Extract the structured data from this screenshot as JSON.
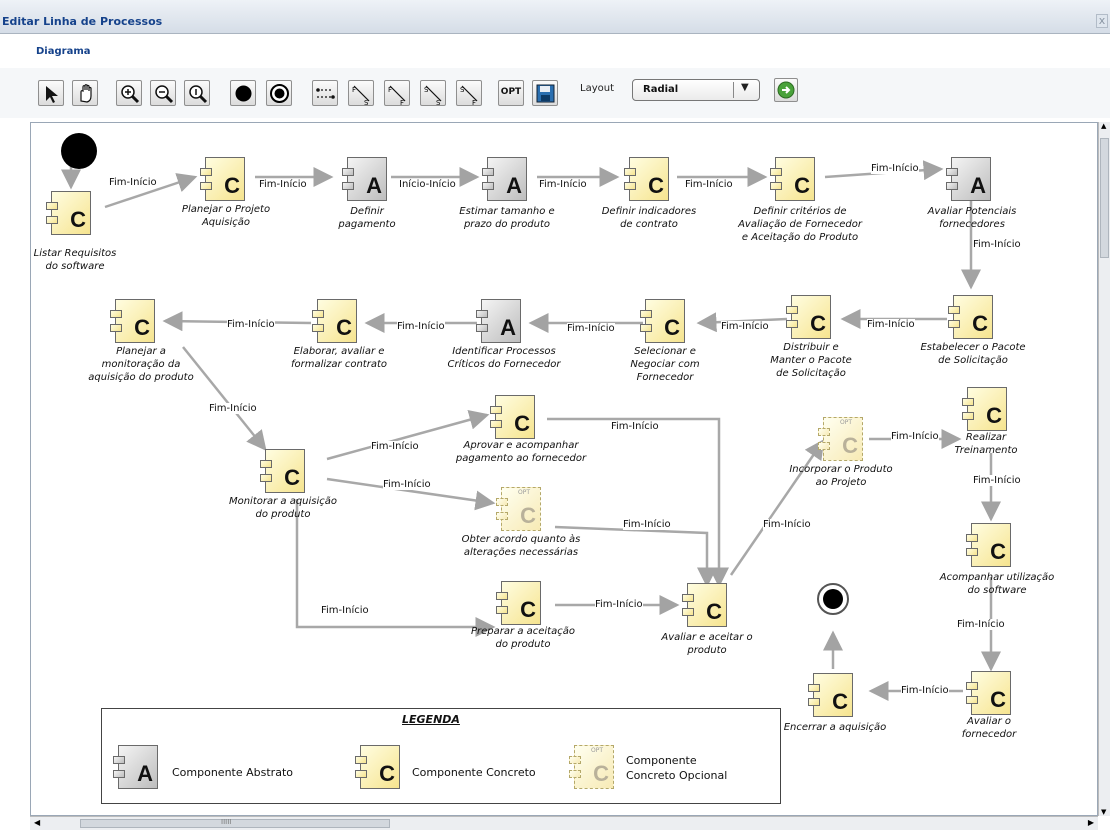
{
  "window": {
    "title": "Editar Linha de Processos",
    "close_label": "x"
  },
  "tab": {
    "label": "Diagrama"
  },
  "toolbar": {
    "tools": [
      {
        "name": "select-arrow-icon"
      },
      {
        "name": "hand-pan-icon"
      },
      {
        "name": "zoom-in-icon"
      },
      {
        "name": "zoom-out-icon"
      },
      {
        "name": "zoom-reset-icon"
      },
      {
        "name": "start-node-icon"
      },
      {
        "name": "end-node-icon"
      },
      {
        "name": "flow-link-icon"
      },
      {
        "name": "link-fs-icon"
      },
      {
        "name": "link-ff-icon"
      },
      {
        "name": "link-ss-icon"
      },
      {
        "name": "link-sf-icon"
      }
    ],
    "opt_label": "OPT",
    "layout_label": "Layout",
    "layout_value": "Radial"
  },
  "nodes": {
    "n1": {
      "letter": "C",
      "label": [
        "Listar Requisitos",
        "do software"
      ]
    },
    "n2": {
      "letter": "C",
      "label": [
        "Planejar o Projeto",
        "Aquisição"
      ]
    },
    "n3": {
      "letter": "A",
      "label": [
        "Definir",
        "pagamento"
      ]
    },
    "n4": {
      "letter": "A",
      "label": [
        "Estimar tamanho e",
        "prazo do produto"
      ]
    },
    "n5": {
      "letter": "C",
      "label": [
        "Definir indicadores",
        "de contrato"
      ]
    },
    "n6": {
      "letter": "C",
      "label": [
        "Definir critérios de",
        "Avaliação de Fornecedor",
        "e Aceitação do Produto"
      ]
    },
    "n7": {
      "letter": "A",
      "label": [
        "Avaliar Potenciais",
        "fornecedores"
      ]
    },
    "n8": {
      "letter": "C",
      "label": [
        "Estabelecer o Pacote",
        "de Solicitação"
      ]
    },
    "n9": {
      "letter": "C",
      "label": [
        "Distribuir e",
        "Manter o Pacote",
        "de Solicitação"
      ]
    },
    "n10": {
      "letter": "C",
      "label": [
        "Selecionar e",
        "Negociar com",
        "Fornecedor"
      ]
    },
    "n11": {
      "letter": "A",
      "label": [
        "Identificar Processos",
        "Críticos do Fornecedor"
      ]
    },
    "n12": {
      "letter": "C",
      "label": [
        "Elaborar, avaliar e",
        "formalizar contrato"
      ]
    },
    "n13": {
      "letter": "C",
      "label": [
        "Planejar a",
        "monitoração da",
        "aquisição do produto"
      ]
    },
    "n14": {
      "letter": "C",
      "label": [
        "Monitorar a aquisição",
        "do produto"
      ]
    },
    "n15": {
      "letter": "C",
      "label": [
        "Aprovar e acompanhar",
        "pagamento ao fornecedor"
      ]
    },
    "n16": {
      "letter": "C",
      "opt": "OPT",
      "label": [
        "Obter acordo quanto às",
        "alterações necessárias"
      ]
    },
    "n17": {
      "letter": "C",
      "label": [
        "Preparar a aceitação",
        "do produto"
      ]
    },
    "n18": {
      "letter": "C",
      "label": [
        "Avaliar e aceitar o",
        "produto"
      ]
    },
    "n19": {
      "letter": "C",
      "opt": "OPT",
      "label": [
        "Incorporar o Produto",
        "ao Projeto"
      ]
    },
    "n20": {
      "letter": "C",
      "label": [
        "Realizar",
        "Treinamento"
      ]
    },
    "n21": {
      "letter": "C",
      "label": [
        "Acompanhar utilização",
        "do software"
      ]
    },
    "n22": {
      "letter": "C",
      "label": [
        "Avaliar o",
        "fornecedor"
      ]
    },
    "n23": {
      "letter": "C",
      "label": [
        "Encerrar a aquisição"
      ]
    }
  },
  "edges": {
    "fi": "Fim-Início",
    "ii": "Início-Início"
  },
  "legend": {
    "title": "LEGENDA",
    "abstract": "Componente Abstrato",
    "concrete": "Componente Concreto",
    "optional": [
      "Componente",
      "Concreto Opcional"
    ],
    "letter_a": "A",
    "letter_c": "C",
    "opt_tag": "OPT"
  },
  "scrollbar": {
    "grip": "IIIII"
  }
}
